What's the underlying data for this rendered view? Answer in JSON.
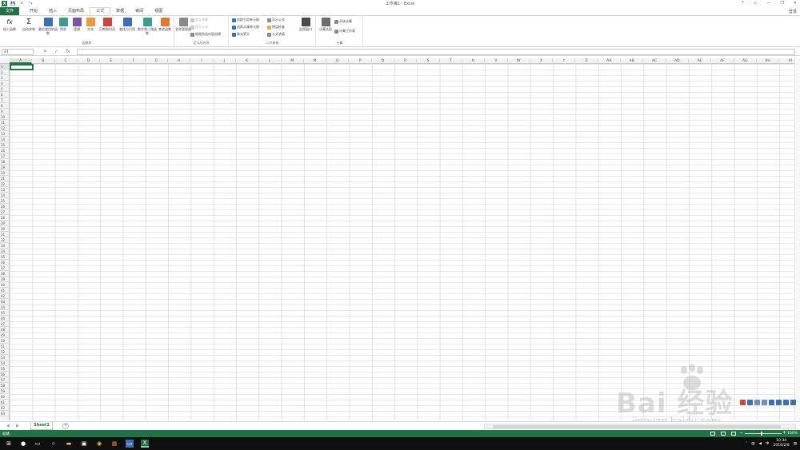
{
  "window": {
    "title": "工作簿1 - Excel",
    "controls": [
      "?",
      "▭",
      "—",
      "❐",
      "✕"
    ],
    "signin": "登录"
  },
  "qat": [
    "X",
    "💾",
    "↶",
    "↷"
  ],
  "tabs": [
    "文件",
    "开始",
    "插入",
    "页面布局",
    "公式",
    "数据",
    "审阅",
    "视图"
  ],
  "active_tab": "公式",
  "ribbon": {
    "function_library": {
      "label": "函数库",
      "buttons": [
        {
          "label": "插入函数",
          "icon": "fx-icon"
        },
        {
          "label": "自动求和",
          "icon": "sigma-icon"
        },
        {
          "label": "最近使用的函数",
          "icon": "star-icon"
        },
        {
          "label": "财务",
          "icon": "finance-icon"
        },
        {
          "label": "逻辑",
          "icon": "logic-icon"
        },
        {
          "label": "文本",
          "icon": "text-icon"
        },
        {
          "label": "日期和时间",
          "icon": "calendar-icon"
        },
        {
          "label": "查找与引用",
          "icon": "lookup-icon"
        },
        {
          "label": "数学和三角函数",
          "icon": "math-icon"
        },
        {
          "label": "其他函数",
          "icon": "more-icon"
        }
      ]
    },
    "defined_names": {
      "label": "定义的名称",
      "manager": "名称管理器",
      "items": [
        "定义名称",
        "用于公式",
        "根据所选内容创建"
      ]
    },
    "formula_auditing": {
      "label": "公式审核",
      "items": [
        "追踪引用单元格",
        "追踪从属单元格",
        "移去箭头",
        "显示公式",
        "错误检查",
        "公式求值"
      ],
      "watch": "监视窗口"
    },
    "calculation": {
      "label": "计算",
      "options": "计算选项",
      "items": [
        "开始计算",
        "计算工作表"
      ]
    }
  },
  "formula_bar": {
    "name_box": "A1",
    "cancel": "✕",
    "enter": "✓",
    "fx": "fx",
    "value": ""
  },
  "grid": {
    "columns": [
      "A",
      "B",
      "C",
      "D",
      "E",
      "F",
      "G",
      "H",
      "I",
      "J",
      "K",
      "L",
      "M",
      "N",
      "O",
      "P",
      "Q",
      "R",
      "S",
      "T",
      "U",
      "V",
      "W",
      "X",
      "Y",
      "Z",
      "AA",
      "AB",
      "AC",
      "AD",
      "AE",
      "AF",
      "AG",
      "AH",
      "AI"
    ],
    "rows": 63,
    "selected": "A1"
  },
  "sheets": {
    "tabs": [
      "Sheet1"
    ],
    "add": "+"
  },
  "status": {
    "text": "就绪",
    "zoom": "100%"
  },
  "taskbar": {
    "time": "10:34",
    "date": "2016/2/8"
  },
  "watermark": {
    "text": "Bai  经验",
    "url": "jingyan.baidu.com"
  },
  "colors": {
    "excel_green": "#217346",
    "selection": "#217346"
  }
}
